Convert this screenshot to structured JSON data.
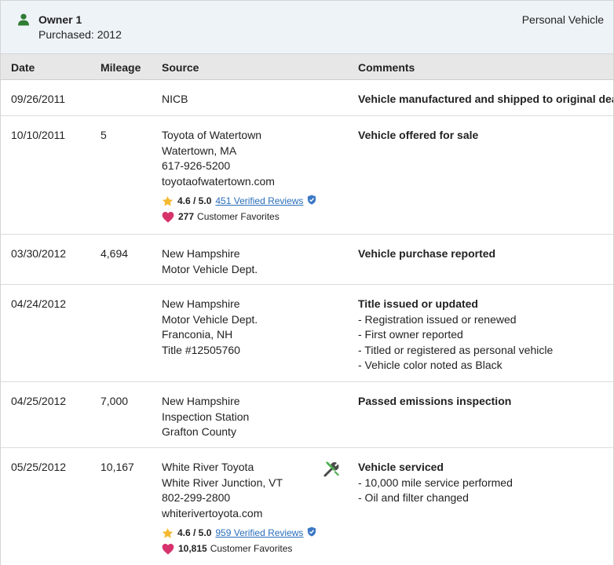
{
  "owner": {
    "title": "Owner 1",
    "purchased": "Purchased: 2012",
    "vehicle_type": "Personal Vehicle",
    "icon": "person-icon",
    "icon_color": "#2e7d32"
  },
  "columns": {
    "date": "Date",
    "mileage": "Mileage",
    "source": "Source",
    "comments": "Comments"
  },
  "rows": [
    {
      "date": "09/26/2011",
      "mileage": "",
      "source": [
        "NICB"
      ],
      "comment_title": "Vehicle manufactured and shipped to original dealer",
      "comment_items": []
    },
    {
      "date": "10/10/2011",
      "mileage": "5",
      "source": [
        "Toyota of Watertown",
        "Watertown, MA",
        "617-926-5200",
        "toyotaofwatertown.com"
      ],
      "rating": {
        "score": "4.6 / 5.0",
        "reviews": "451 Verified Reviews",
        "favorites_count": "277",
        "favorites_label": "Customer Favorites"
      },
      "comment_title": "Vehicle offered for sale",
      "comment_items": []
    },
    {
      "date": "03/30/2012",
      "mileage": "4,694",
      "source": [
        "New Hampshire",
        "Motor Vehicle Dept."
      ],
      "comment_title": "Vehicle purchase reported",
      "comment_items": []
    },
    {
      "date": "04/24/2012",
      "mileage": "",
      "source": [
        "New Hampshire",
        "Motor Vehicle Dept.",
        "Franconia, NH",
        "Title #12505760"
      ],
      "comment_title": "Title issued or updated",
      "comment_items": [
        "- Registration issued or renewed",
        "- First owner reported",
        "- Titled or registered as personal vehicle",
        "- Vehicle color noted as Black"
      ]
    },
    {
      "date": "04/25/2012",
      "mileage": "7,000",
      "source": [
        "New Hampshire",
        "Inspection Station",
        "Grafton County"
      ],
      "comment_title": "Passed emissions inspection",
      "comment_items": []
    },
    {
      "date": "05/25/2012",
      "mileage": "10,167",
      "source": [
        "White River Toyota",
        "White River Junction, VT",
        "802-299-2800",
        "whiterivertoyota.com"
      ],
      "rating": {
        "score": "4.6 / 5.0",
        "reviews": "959 Verified Reviews",
        "favorites_count": "10,815",
        "favorites_label": "Customer Favorites"
      },
      "service_icon": "wrench-screwdriver-icon",
      "comment_title": "Vehicle serviced",
      "comment_items": [
        "- 10,000 mile service performed",
        "- Oil and filter changed"
      ]
    }
  ],
  "colors": {
    "header_bg": "#eef3f8",
    "column_header_bg": "#e7e7e7",
    "link": "#2a6ebb",
    "star": "#f5b82e",
    "heart": "#d6336c",
    "verified": "#3b78c4"
  }
}
